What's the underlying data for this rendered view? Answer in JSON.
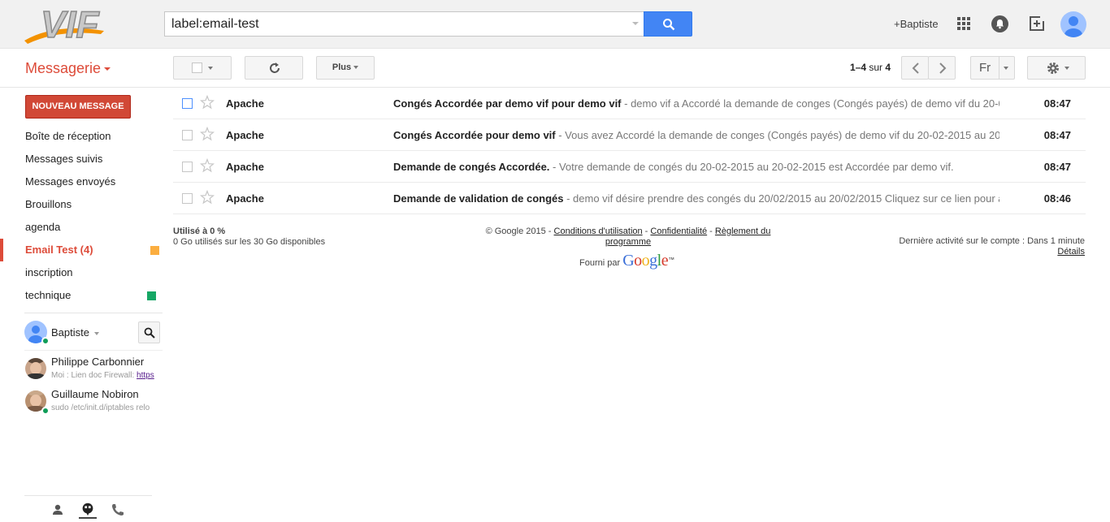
{
  "header": {
    "logo_alt": "VIF",
    "search_value": "label:email-test",
    "user_link": "+Baptiste",
    "colors": {
      "search_button": "#4285f4",
      "header_bg": "#f1f1f1"
    }
  },
  "toolbar": {
    "app_title": "Messagerie",
    "more_label": "Plus",
    "pager_range": "1–4",
    "pager_of": "sur",
    "pager_total": "4",
    "language": "Fr"
  },
  "sidebar": {
    "compose_label": "NOUVEAU MESSAGE",
    "items": [
      {
        "label": "Boîte de réception"
      },
      {
        "label": "Messages suivis"
      },
      {
        "label": "Messages envoyés"
      },
      {
        "label": "Brouillons"
      },
      {
        "label": "agenda"
      },
      {
        "label": "Email Test (4)",
        "active": true,
        "color": "#fbae40"
      },
      {
        "label": "inscription"
      },
      {
        "label": "technique",
        "color": "#16a765"
      }
    ]
  },
  "chat": {
    "me": "Baptiste",
    "contacts": [
      {
        "name": "Philippe Carbonnier",
        "message": "Moi : Lien doc Firewall: ",
        "link": "https"
      },
      {
        "name": "Guillaume Nobiron",
        "message": "sudo /etc/init.d/iptables relo"
      }
    ]
  },
  "mails": [
    {
      "sender": "Apache",
      "subject": "Congés Accordée par demo vif pour demo vif",
      "snippet": " - demo vif a Accordé la demande de conges (Congés payés) de demo vif du 20-0",
      "time": "08:47"
    },
    {
      "sender": "Apache",
      "subject": "Congés Accordée pour demo vif",
      "snippet": " - Vous avez Accordé la demande de conges (Congés payés) de demo vif du 20-02-2015 au 20-(",
      "time": "08:47"
    },
    {
      "sender": "Apache",
      "subject": "Demande de congés Accordée.",
      "snippet": " - Votre demande de congés du 20-02-2015 au 20-02-2015 est Accordée par demo vif.",
      "time": "08:47"
    },
    {
      "sender": "Apache",
      "subject": "Demande de validation de congés",
      "snippet": " - demo vif désire prendre des congés du 20/02/2015 au 20/02/2015 Cliquez sur ce lien pour ac",
      "time": "08:46"
    }
  ],
  "footer": {
    "usage_title": "Utilisé à 0 %",
    "usage_detail": "0 Go utilisés sur les 30 Go disponibles",
    "copyright": "© Google 2015 - ",
    "terms": "Conditions d'utilisation",
    "sep1": " - ",
    "privacy": "Confidentialité",
    "sep2": " - ",
    "program": "Règlement du programme",
    "powered_by": "Fourni par",
    "google": "Google",
    "tm": "™",
    "last_activity": "Dernière activité sur le compte : Dans 1 minute",
    "details": "Détails"
  }
}
